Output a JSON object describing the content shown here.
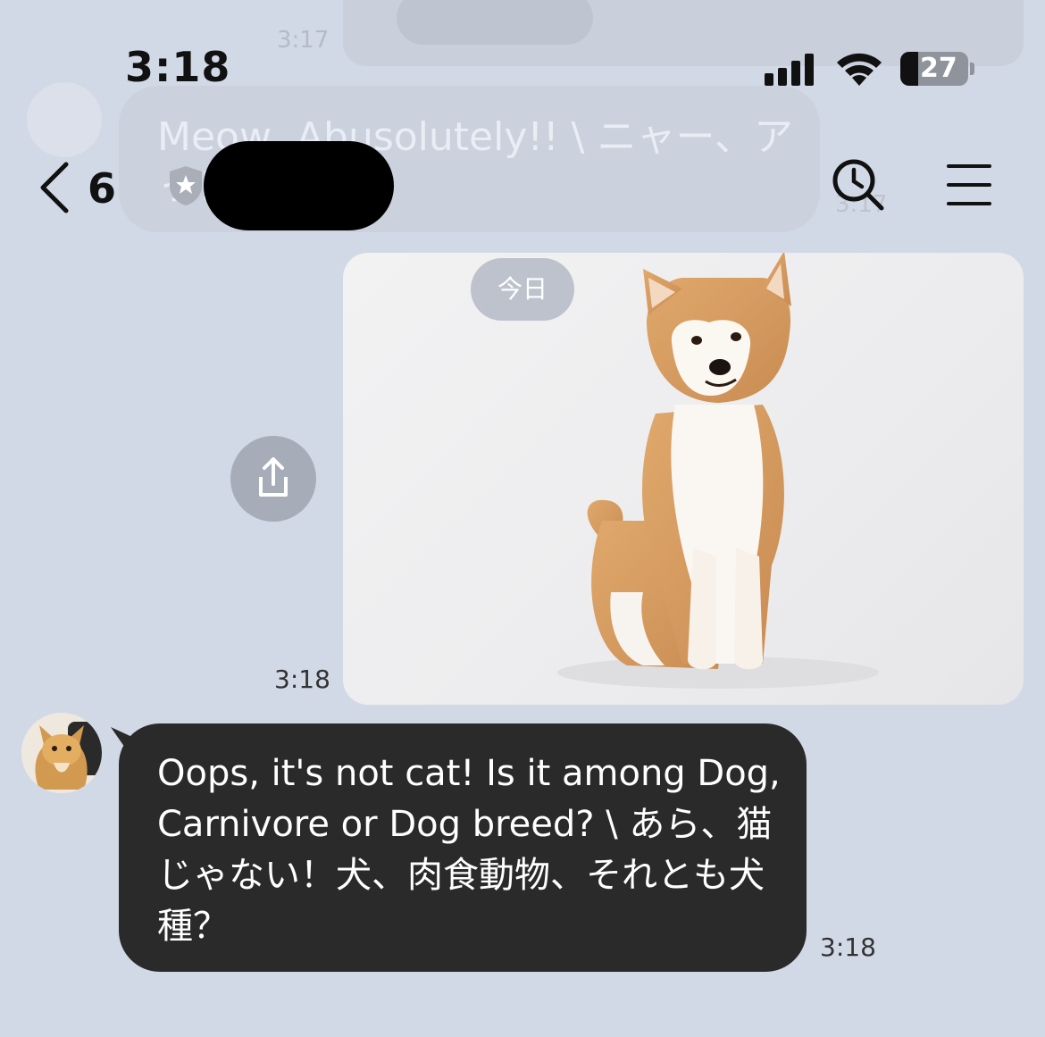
{
  "status_bar": {
    "time": "3:18",
    "battery_level": "27"
  },
  "ghost": {
    "top_time": "3:17",
    "message_text": "Meow, Abusolutely!! \\ ニャー、ア\nっ！」！",
    "side_time": "3:17"
  },
  "nav": {
    "unread_count": "6",
    "icons": {
      "back": "chevron-left-icon",
      "search": "search-history-icon",
      "menu": "menu-icon"
    }
  },
  "chat": {
    "date_chip": "今日",
    "image_message": {
      "subject": "dog-photo",
      "time": "3:18"
    },
    "received_message": {
      "text": "Oops, it's not cat! Is it among Dog, Carnivore or Dog breed? \\ あら、猫じゃない！犬、肉食動物、それとも犬種？",
      "time": "3:18"
    }
  }
}
